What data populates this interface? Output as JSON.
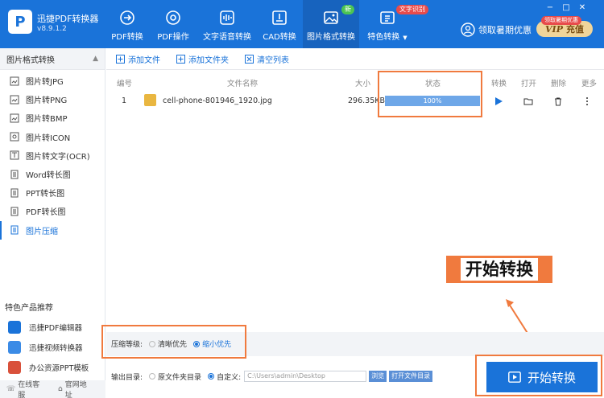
{
  "app": {
    "name": "迅捷PDF转换器",
    "version": "v8.9.1.2"
  },
  "nav": [
    {
      "label": "PDF转换",
      "icon": "pdf-convert-icon"
    },
    {
      "label": "PDF操作",
      "icon": "pdf-operate-icon"
    },
    {
      "label": "文字语音转换",
      "icon": "audio-wave-icon"
    },
    {
      "label": "CAD转换",
      "icon": "cad-icon"
    },
    {
      "label": "图片格式转换",
      "icon": "image-icon",
      "badge": "新"
    },
    {
      "label": "特色转换",
      "icon": "special-convert-icon",
      "badge": "文字识别"
    }
  ],
  "header": {
    "promo": "领取暑期优惠",
    "vip_tag": "领取暑期优惠",
    "vip_v": "VIP",
    "vip_label": "充值"
  },
  "window": {
    "min": "−",
    "max": "□",
    "close": "✕"
  },
  "sidebar": {
    "title": "图片格式转换",
    "items": [
      "图片转JPG",
      "图片转PNG",
      "图片转BMP",
      "图片转ICON",
      "图片转文字(OCR)",
      "Word转长图",
      "PPT转长图",
      "PDF转长图",
      "图片压缩"
    ],
    "active_index": 8,
    "recommend_title": "特色产品推荐",
    "recommend": [
      "迅捷PDF编辑器",
      "迅捷视频转换器",
      "办公资源PPT模板"
    ],
    "footer": [
      "在线客服",
      "官网地址"
    ]
  },
  "toolbar": {
    "add_file": "添加文件",
    "add_folder": "添加文件夹",
    "clear_list": "清空列表"
  },
  "table": {
    "headers": {
      "index": "编号",
      "name": "文件名称",
      "size": "大小",
      "status": "状态",
      "convert": "转换",
      "open": "打开",
      "delete": "删除",
      "more": "更多"
    },
    "rows": [
      {
        "index": "1",
        "name": "cell-phone-801946_1920.jpg",
        "size": "296.35KB",
        "progress": "100%"
      }
    ]
  },
  "options": {
    "label": "压缩等级:",
    "opt1": "清晰优先",
    "opt2": "缩小优先",
    "selected": "缩小优先"
  },
  "output": {
    "label": "输出目录:",
    "opt1": "原文件夹目录",
    "opt2": "自定义:",
    "path": "C:\\Users\\admin\\Desktop",
    "browse": "浏览",
    "open_folder": "打开文件目录"
  },
  "start_button": "开始转换",
  "callout": "开始转换",
  "colors": {
    "primary": "#1a73d9",
    "annotation": "#f07a3e",
    "progress": "#6ea7e8"
  }
}
